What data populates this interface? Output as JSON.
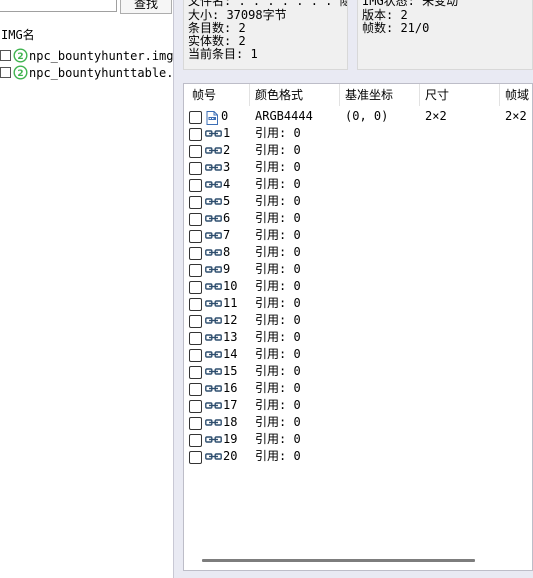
{
  "search": {
    "find_label": "查找"
  },
  "img_list": {
    "header": "IMG名",
    "items": [
      {
        "name": "npc_bountyhunter.img"
      },
      {
        "name": "npc_bountyhunttable.img"
      }
    ]
  },
  "info": {
    "filename": "文件名: . . . . . . . 隐藏:",
    "size": "大小: 37098字节",
    "entries": "条目数: 2",
    "entities": "实体数: 2",
    "current_entry": "当前条目: 1",
    "img_status": "IMG状态: 未变动",
    "version": "版本: 2",
    "frames": "帧数: 21/0"
  },
  "frame_table": {
    "columns": [
      "帧号",
      "颜色格式",
      "基准坐标",
      "尺寸",
      "帧域"
    ],
    "first_row": {
      "index": "0",
      "format": "ARGB4444",
      "coord": "(0, 0)",
      "size": "2×2",
      "domain": "2×2"
    },
    "link_rows": [
      {
        "index": "1",
        "ref": "引用: 0"
      },
      {
        "index": "2",
        "ref": "引用: 0"
      },
      {
        "index": "3",
        "ref": "引用: 0"
      },
      {
        "index": "4",
        "ref": "引用: 0"
      },
      {
        "index": "5",
        "ref": "引用: 0"
      },
      {
        "index": "6",
        "ref": "引用: 0"
      },
      {
        "index": "7",
        "ref": "引用: 0"
      },
      {
        "index": "8",
        "ref": "引用: 0"
      },
      {
        "index": "9",
        "ref": "引用: 0"
      },
      {
        "index": "10",
        "ref": "引用: 0"
      },
      {
        "index": "11",
        "ref": "引用: 0"
      },
      {
        "index": "12",
        "ref": "引用: 0"
      },
      {
        "index": "13",
        "ref": "引用: 0"
      },
      {
        "index": "14",
        "ref": "引用: 0"
      },
      {
        "index": "15",
        "ref": "引用: 0"
      },
      {
        "index": "16",
        "ref": "引用: 0"
      },
      {
        "index": "17",
        "ref": "引用: 0"
      },
      {
        "index": "18",
        "ref": "引用: 0"
      },
      {
        "index": "19",
        "ref": "引用: 0"
      },
      {
        "index": "20",
        "ref": "引用: 0"
      }
    ]
  },
  "icons": {
    "img_file": "green-img-file-icon",
    "frame_image": "image-file-icon",
    "frame_link": "link-icon"
  },
  "colors": {
    "panel_bg": "#e9eaf3",
    "info_bg": "#f0f0f0",
    "img_icon": "#3fb34f",
    "link_icon": "#2f4f6f"
  }
}
